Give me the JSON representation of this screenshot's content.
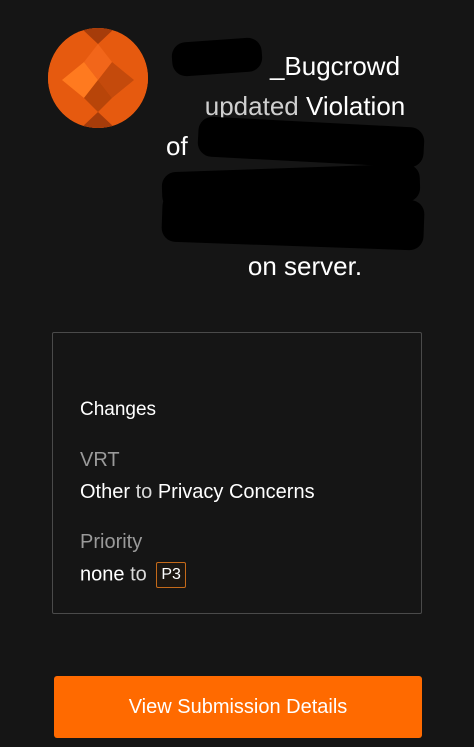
{
  "notification": {
    "user_visible": "_Bugcrowd",
    "action": "updated",
    "object": "Violation",
    "prep": "of",
    "ending": "on server."
  },
  "changes": {
    "title": "Changes",
    "vrt_label": "VRT",
    "vrt_from": "Other",
    "vrt_connector": "to",
    "vrt_to": "Privacy Concerns",
    "priority_label": "Priority",
    "priority_from": "none",
    "priority_connector": "to",
    "priority_to": "P3"
  },
  "button": {
    "label": "View Submission Details"
  },
  "colors": {
    "accent": "#ff6a00",
    "background": "#151515",
    "card_border": "#4a4a4a",
    "avatar": "#e65a0f"
  },
  "icons": {
    "avatar": "bugcrowd-logo-icon"
  }
}
